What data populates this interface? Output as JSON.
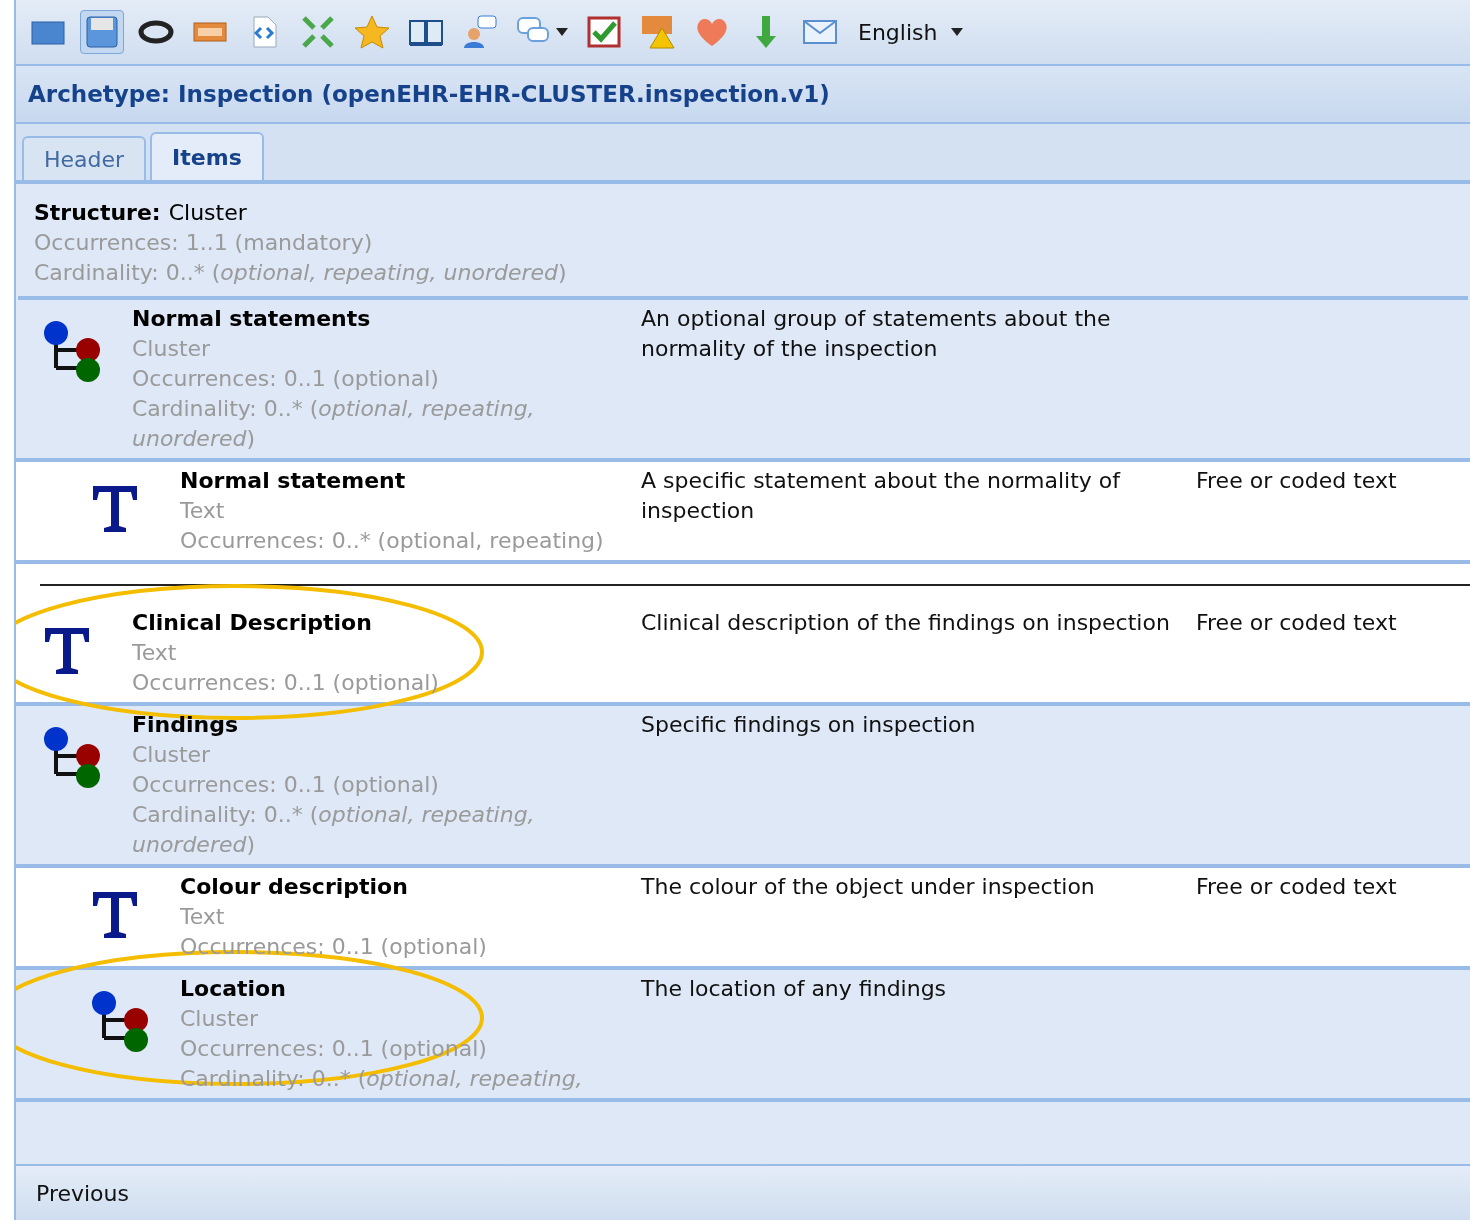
{
  "toolbar": {
    "buttons": [
      {
        "selected": false
      },
      {
        "selected": true
      },
      {
        "selected": false
      },
      {
        "selected": false
      },
      {
        "selected": false
      },
      {
        "selected": false
      },
      {
        "selected": false
      },
      {
        "selected": false
      },
      {
        "selected": false
      },
      {
        "selected": false
      },
      {
        "selected": false
      },
      {
        "selected": false
      },
      {
        "selected": false
      },
      {
        "selected": false
      },
      {
        "selected": false
      }
    ],
    "language": "English"
  },
  "title": "Archetype: Inspection (openEHR-EHR-CLUSTER.inspection.v1)",
  "tabs": [
    {
      "label": "Header",
      "selected": false
    },
    {
      "label": "Items",
      "selected": true
    }
  ],
  "structure": {
    "label": "Structure:",
    "value": "Cluster",
    "occurrences": "Occurrences: 1..1 (mandatory)",
    "cardinality": "Cardinality: 0..* (*optional, repeating, unordered*)"
  },
  "items": [
    {
      "kind": "cluster",
      "name": "Normal statements",
      "type": "Cluster",
      "occurrences": "Occurrences: 0..1 (optional)",
      "cardinality": "Cardinality: 0..* (*optional, repeating, unordered*)",
      "description": "An optional group of statements about the normality of the inspection",
      "highlighted": false,
      "children": [
        {
          "kind": "text",
          "name": "Normal statement",
          "type": "Text",
          "occurrences": "Occurrences: 0..* (optional, repeating)",
          "description": "A specific statement about the normality of inspection",
          "datatype": "Free or coded text",
          "highlighted": false
        }
      ]
    },
    {
      "kind": "separator"
    },
    {
      "kind": "text",
      "name": "Clinical Description",
      "type": "Text",
      "occurrences": "Occurrences: 0..1 (optional)",
      "description": "Clinical description of the findings on inspection",
      "datatype": "Free or coded text",
      "highlighted": true
    },
    {
      "kind": "cluster",
      "name": "Findings",
      "type": "Cluster",
      "occurrences": "Occurrences: 0..1 (optional)",
      "cardinality": "Cardinality: 0..* (*optional, repeating, unordered*)",
      "description": "Specific findings on inspection",
      "highlighted": false,
      "children": [
        {
          "kind": "text",
          "name": "Colour description",
          "type": "Text",
          "occurrences": "Occurrences: 0..1 (optional)",
          "description": "The colour of the object under inspection",
          "datatype": "Free or coded text",
          "highlighted": false
        },
        {
          "kind": "cluster",
          "name": "Location",
          "type": "Cluster",
          "occurrences": "Occurrences: 0..1 (optional)",
          "cardinality": "Cardinality: 0..* (*optional, repeating,*",
          "description": "The location of any findings",
          "highlighted": true
        }
      ]
    }
  ],
  "footer": {
    "previous": "Previous"
  }
}
